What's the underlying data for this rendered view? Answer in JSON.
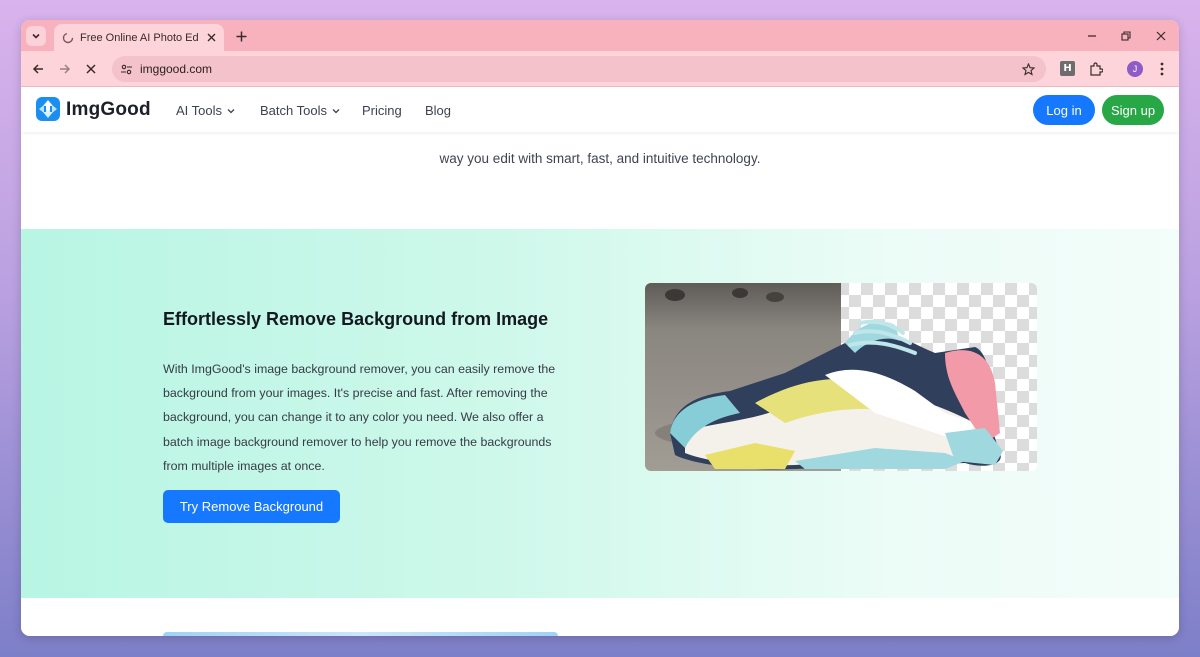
{
  "browser": {
    "tab_title": "Free Online AI Photo Editor | Im",
    "url": "imggood.com",
    "profile_initial": "J",
    "extension_label": "H"
  },
  "nav": {
    "brand": "ImgGood",
    "items": [
      {
        "label": "AI Tools",
        "has_dropdown": true
      },
      {
        "label": "Batch Tools",
        "has_dropdown": true
      },
      {
        "label": "Pricing",
        "has_dropdown": false
      },
      {
        "label": "Blog",
        "has_dropdown": false
      }
    ],
    "login": "Log in",
    "signup": "Sign up"
  },
  "intro_tail": "way you edit with smart, fast, and intuitive technology.",
  "feature": {
    "title": "Effortlessly Remove Background from Image",
    "description": "With ImgGood's image background remover, you can easily remove the background from your images. It's precise and fast. After removing the background, you can change it to any color you need. We also offer a batch image background remover to help you remove the backgrounds from multiple images at once.",
    "cta": "Try Remove Background"
  },
  "colors": {
    "tabstrip": "#f7b2bd",
    "toolbar": "#fcd4da",
    "primary": "#1677ff",
    "signup": "#27a745",
    "feature_bg": "#b8f5e3"
  }
}
